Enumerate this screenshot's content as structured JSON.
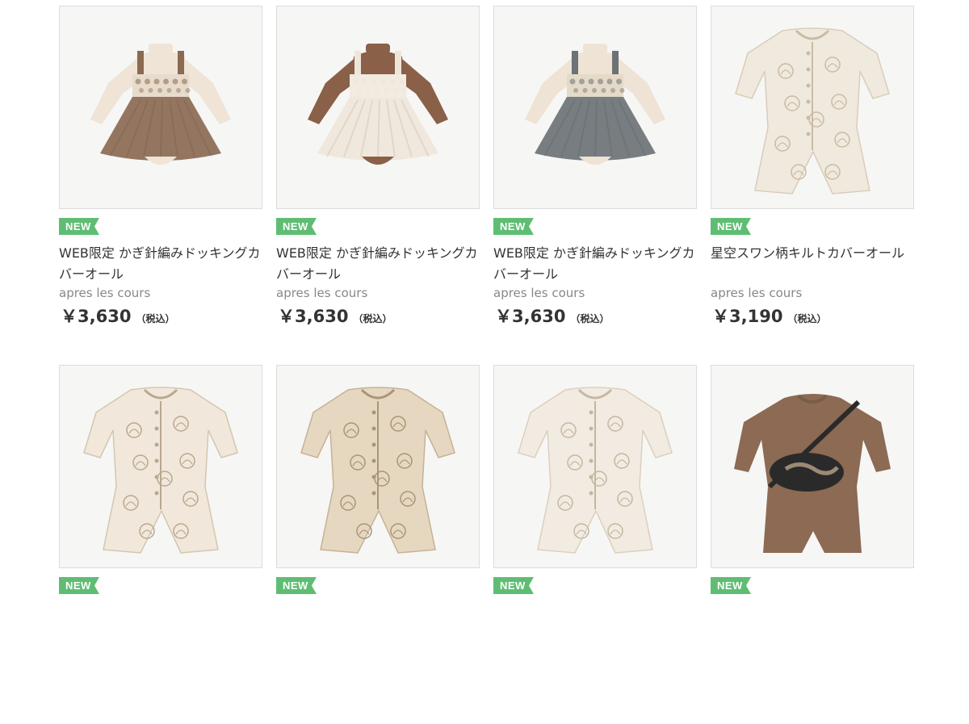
{
  "products": [
    {
      "badge": "NEW",
      "title": "WEB限定 かぎ針編みドッキングカバーオール",
      "brand": "apres les cours",
      "price": "￥3,630",
      "tax": "（税込）",
      "image_icon": "brown-tulle-dress-romper",
      "colors": {
        "body": "#efe4d6",
        "dress": "#8b6a52",
        "trim": "#e7dccb"
      }
    },
    {
      "badge": "NEW",
      "title": "WEB限定 かぎ針編みドッキングカバーオール",
      "brand": "apres les cours",
      "price": "￥3,630",
      "tax": "（税込）",
      "image_icon": "cream-tulle-dress-romper",
      "colors": {
        "body": "#8a6048",
        "dress": "#efe6da",
        "trim": "#f2ebe0"
      }
    },
    {
      "badge": "NEW",
      "title": "WEB限定 かぎ針編みドッキングカバーオール",
      "brand": "apres les cours",
      "price": "￥3,630",
      "tax": "（税込）",
      "image_icon": "gray-tulle-dress-romper",
      "colors": {
        "body": "#eee3d4",
        "dress": "#6c7276",
        "trim": "#e5dac8"
      }
    },
    {
      "badge": "NEW",
      "title": "星空スワン柄キルトカバーオール",
      "brand": "apres les cours",
      "price": "￥3,190",
      "tax": "（税込）",
      "image_icon": "quilted-coverall",
      "colors": {
        "body": "#f0e9dd",
        "dress": "#d9cdb9",
        "trim": "#c9bba4"
      }
    },
    {
      "badge": "NEW",
      "title": "",
      "brand": "",
      "price": "",
      "tax": "",
      "image_icon": "quilted-coverall",
      "colors": {
        "body": "#f1e8db",
        "dress": "#d4c6ae",
        "trim": "#b8a88e"
      }
    },
    {
      "badge": "NEW",
      "title": "",
      "brand": "",
      "price": "",
      "tax": "",
      "image_icon": "quilted-coverall",
      "colors": {
        "body": "#e6d7c0",
        "dress": "#c6b296",
        "trim": "#a99577"
      }
    },
    {
      "badge": "NEW",
      "title": "",
      "brand": "",
      "price": "",
      "tax": "",
      "image_icon": "quilted-coverall",
      "colors": {
        "body": "#f2ebe1",
        "dress": "#dcd0bd",
        "trim": "#c4b7a1"
      }
    },
    {
      "badge": "NEW",
      "title": "",
      "brand": "",
      "price": "",
      "tax": "",
      "image_icon": "sweat-coverall-with-pouch",
      "colors": {
        "body": "#8c6a53",
        "dress": "#2a2a2a",
        "trim": "#7a5d48"
      }
    }
  ]
}
